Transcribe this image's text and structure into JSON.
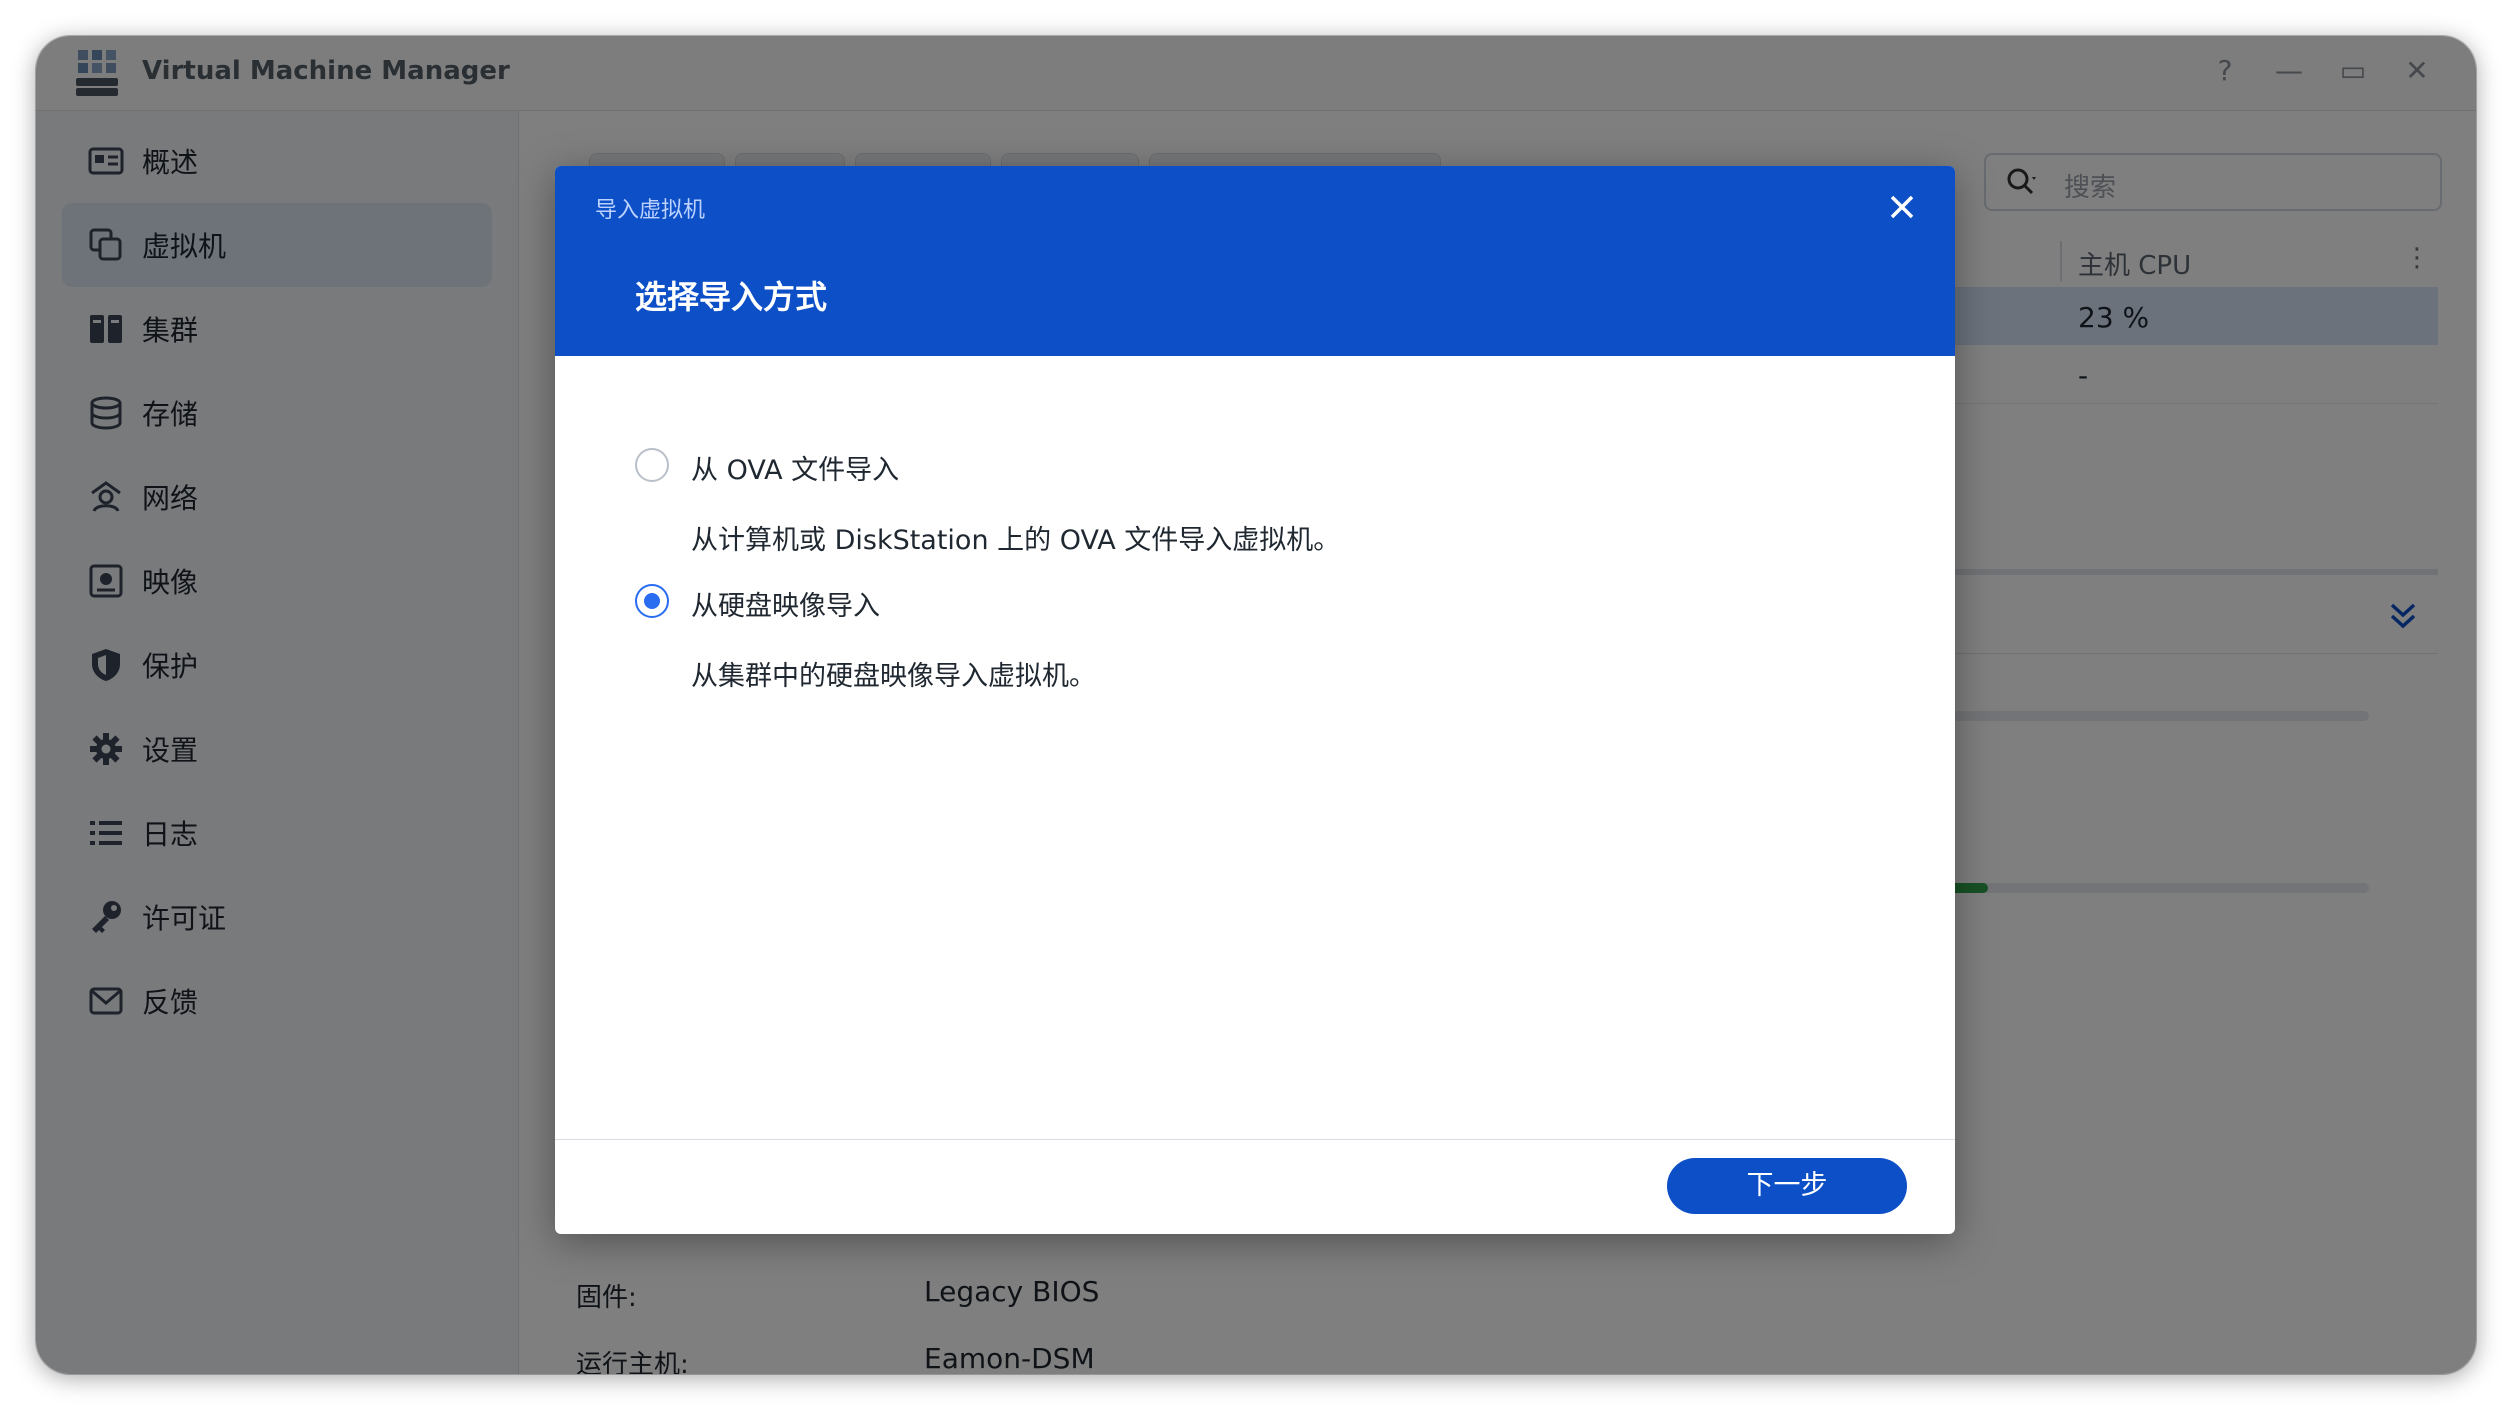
{
  "window": {
    "title": "Virtual Machine Manager",
    "controls": {
      "help": "?",
      "minimize": "—",
      "maximize": "▭",
      "close": "✕"
    }
  },
  "sidebar": {
    "items": [
      {
        "label": "概述",
        "icon": "overview-icon"
      },
      {
        "label": "虚拟机",
        "icon": "virtual-machine-icon",
        "active": true
      },
      {
        "label": "集群",
        "icon": "cluster-icon"
      },
      {
        "label": "存储",
        "icon": "storage-icon"
      },
      {
        "label": "网络",
        "icon": "network-icon"
      },
      {
        "label": "映像",
        "icon": "image-icon"
      },
      {
        "label": "保护",
        "icon": "shield-icon"
      },
      {
        "label": "设置",
        "icon": "gear-icon"
      },
      {
        "label": "日志",
        "icon": "log-icon"
      },
      {
        "label": "许可证",
        "icon": "key-icon"
      },
      {
        "label": "反馈",
        "icon": "mail-icon"
      }
    ]
  },
  "main": {
    "search": {
      "placeholder": "搜索"
    },
    "table": {
      "column": "主机 CPU",
      "rows": [
        {
          "cpu": "23 %"
        },
        {
          "cpu": "-"
        }
      ]
    },
    "memory_usage_fraction": 0.3,
    "properties": [
      {
        "label": "固件:",
        "value": "Legacy BIOS"
      },
      {
        "label": "运行主机:",
        "value": "Eamon-DSM"
      }
    ]
  },
  "dialog": {
    "subtitle": "导入虚拟机",
    "title": "选择导入方式",
    "options": [
      {
        "label": "从 OVA 文件导入",
        "description": "从计算机或 DiskStation 上的 OVA 文件导入虚拟机。",
        "checked": false
      },
      {
        "label": "从硬盘映像导入",
        "description": "从集群中的硬盘映像导入虚拟机。",
        "checked": true
      }
    ],
    "next_label": "下一步"
  },
  "colors": {
    "accent": "#0c4fc7",
    "radio_selected": "#2a6cf0",
    "sidebar_active": "#dde7f5"
  }
}
